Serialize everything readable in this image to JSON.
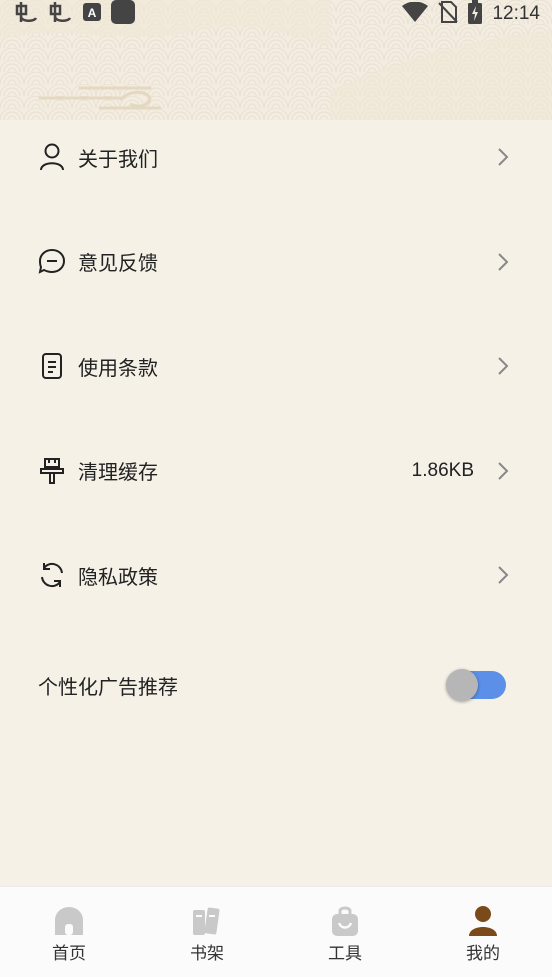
{
  "status_bar": {
    "time": "12:14",
    "left_icons": [
      "app-icon-1",
      "app-icon-2",
      "font-icon",
      "square-icon"
    ],
    "right_icons": [
      "wifi-icon",
      "no-sim-icon",
      "battery-charging-icon"
    ]
  },
  "menu": {
    "items": [
      {
        "label": "关于我们",
        "icon": "person-icon",
        "value": ""
      },
      {
        "label": "意见反馈",
        "icon": "chat-bubble-icon",
        "value": ""
      },
      {
        "label": "使用条款",
        "icon": "document-icon",
        "value": ""
      },
      {
        "label": "清理缓存",
        "icon": "brush-icon",
        "value": "1.86KB"
      },
      {
        "label": "隐私政策",
        "icon": "refresh-icon",
        "value": ""
      }
    ]
  },
  "ad_toggle": {
    "label": "个性化广告推荐",
    "enabled": true
  },
  "colors": {
    "background": "#f6f1e7",
    "toggle_track": "#5b8fe8",
    "active_tab": "#7a4a1a",
    "inactive_tab_icon": "#c9c9c9"
  },
  "tabbar": {
    "tabs": [
      {
        "label": "首页",
        "icon": "home-icon",
        "active": false
      },
      {
        "label": "书架",
        "icon": "books-icon",
        "active": false
      },
      {
        "label": "工具",
        "icon": "bag-icon",
        "active": false
      },
      {
        "label": "我的",
        "icon": "user-icon",
        "active": true
      }
    ]
  }
}
